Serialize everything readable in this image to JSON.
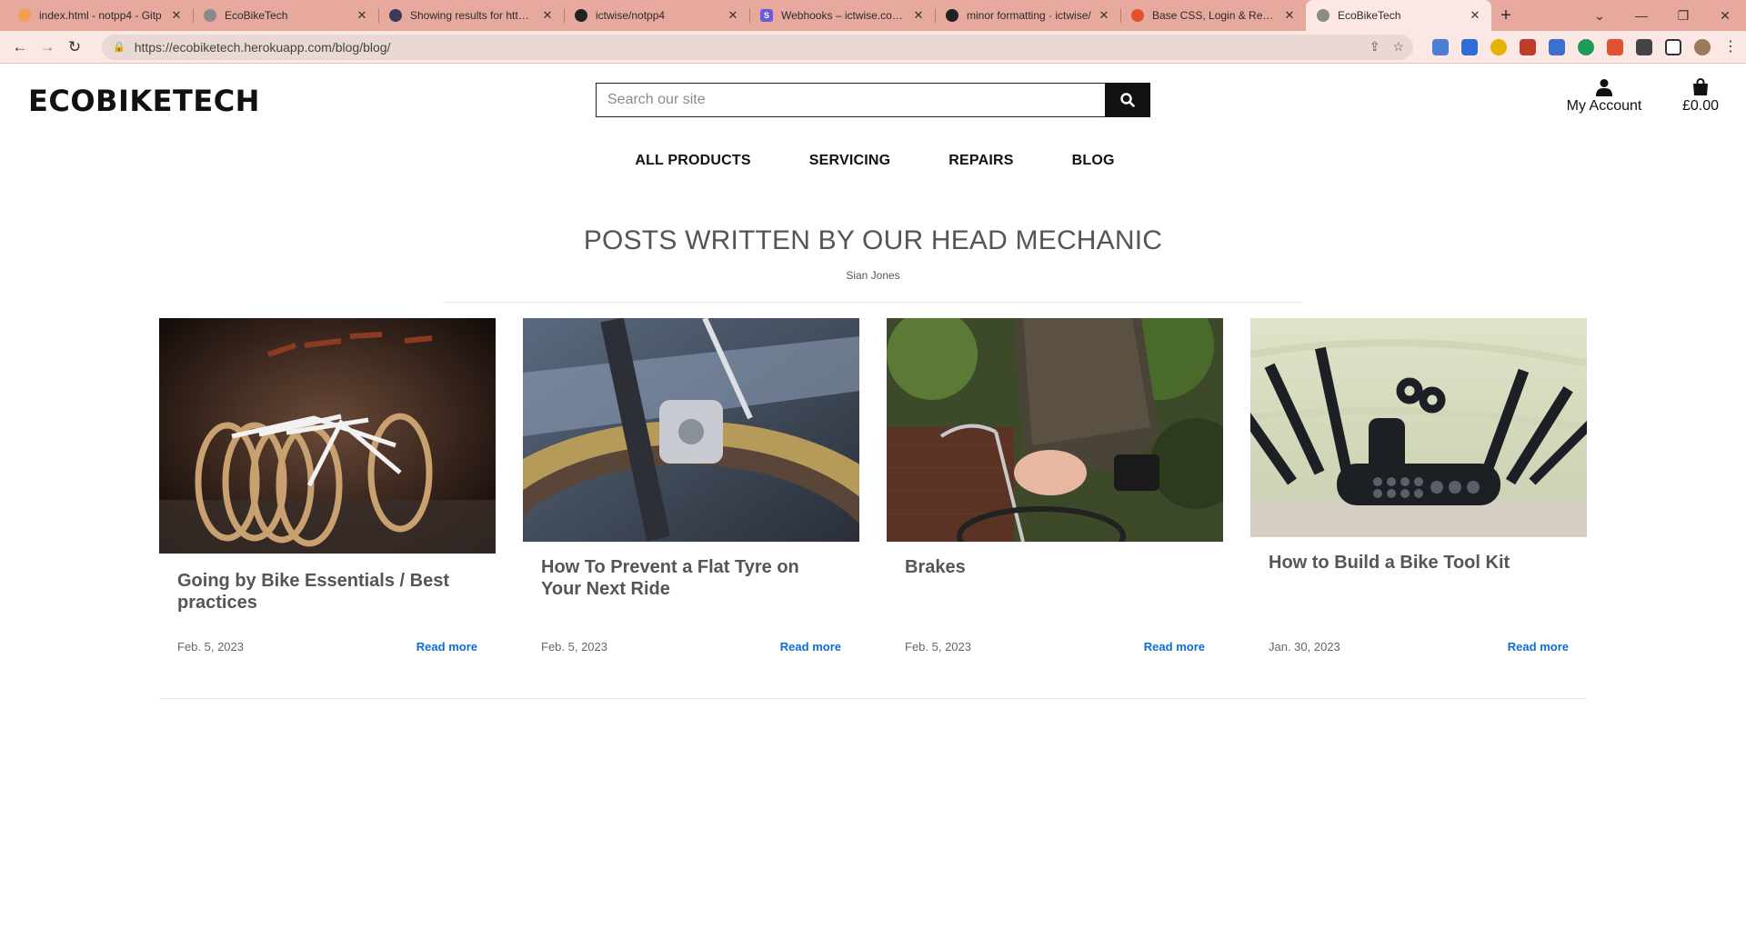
{
  "browser": {
    "tabs": [
      {
        "title": "index.html - notpp4 - Gitp",
        "favicon": "gitpod-icon",
        "color": "#f0a050"
      },
      {
        "title": "EcoBikeTech",
        "favicon": "globe-icon",
        "color": "#777777"
      },
      {
        "title": "Showing results for https:/",
        "favicon": "validator-icon",
        "color": "#3a3a5a"
      },
      {
        "title": "ictwise/notpp4",
        "favicon": "github-icon",
        "color": "#222222"
      },
      {
        "title": "Webhooks – ictwise.co.uk",
        "favicon": "stripe-icon",
        "color": "#6b5bd6"
      },
      {
        "title": "minor formatting · ictwise/",
        "favicon": "github-icon",
        "color": "#222222"
      },
      {
        "title": "Base CSS, Login & Registra",
        "favicon": "codeinstitute-icon",
        "color": "#e2502c"
      },
      {
        "title": "EcoBikeTech",
        "favicon": "globe-icon",
        "color": "#777777"
      }
    ],
    "active_tab": 7,
    "url": "https://ecobiketech.herokuapp.com/blog/blog/",
    "new_tab_glyph": "+",
    "extension_colors": [
      "#4a7fd6",
      "#2c6fd6",
      "#e8b100",
      "#c0392b",
      "#3b6fd0",
      "#1d9b56",
      "#e0532c",
      "#333333",
      "#333333"
    ]
  },
  "site": {
    "logo": "ECOBIKETECH",
    "search": {
      "placeholder": "Search our site"
    },
    "account_label": "My Account",
    "basket_total": "£0.00",
    "nav": [
      "ALL PRODUCTS",
      "SERVICING",
      "REPAIRS",
      "BLOG"
    ]
  },
  "blog": {
    "heading": "POSTS WRITTEN BY OUR HEAD MECHANIC",
    "author": "Sian Jones",
    "read_more": "Read more",
    "posts": [
      {
        "title": "Going by Bike Essentials / Best practices",
        "date": "Feb. 5, 2023",
        "image": "white-bicycles-row"
      },
      {
        "title": "How To Prevent a Flat Tyre on Your Next Ride",
        "date": "Feb. 5, 2023",
        "image": "bicycle-brake-closeup"
      },
      {
        "title": "Brakes",
        "date": "Feb. 5, 2023",
        "image": "woman-riding-bicycle"
      },
      {
        "title": "How to Build a Bike Tool Kit",
        "date": "Jan. 30, 2023",
        "image": "bike-multi-tool"
      }
    ]
  },
  "colors": {
    "link": "#0c6fd8",
    "chrome_tabs": "#e7a99e",
    "chrome_toolbar": "#fbe7e3"
  }
}
